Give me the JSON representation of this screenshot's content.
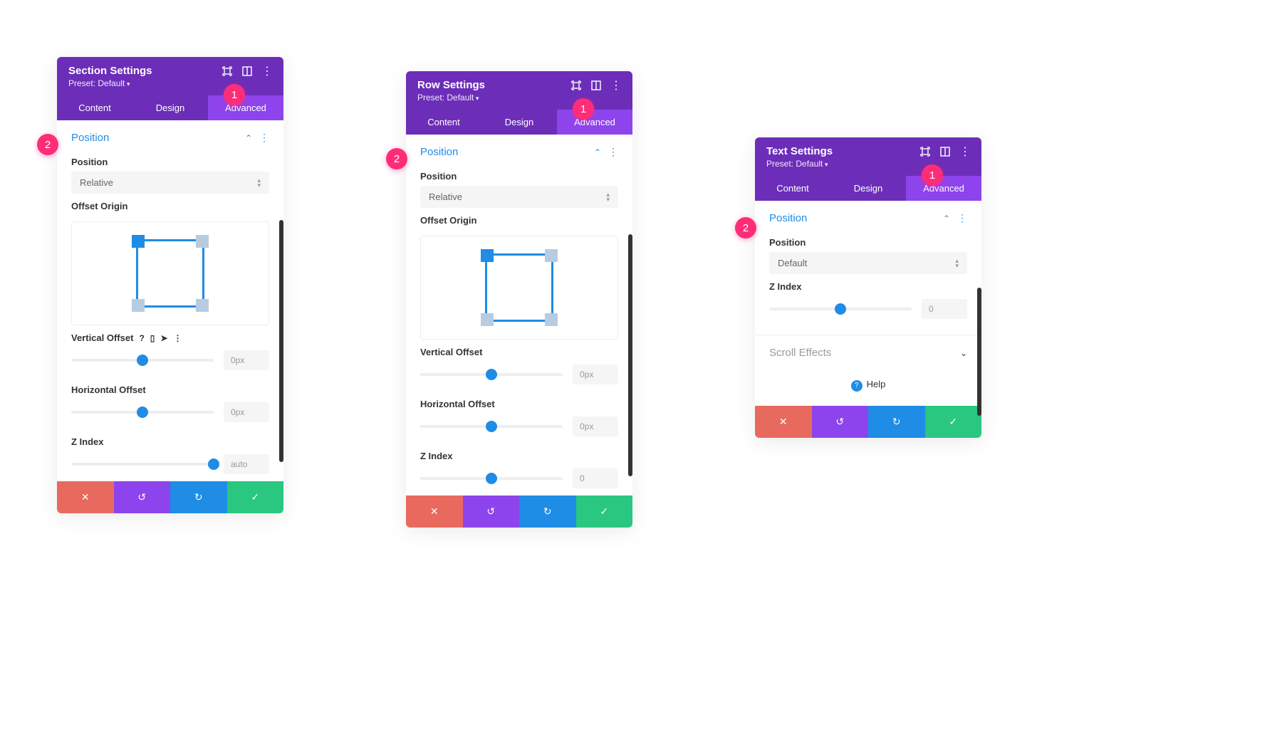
{
  "panels": [
    {
      "title": "Section Settings",
      "preset": "Preset: Default",
      "tabs": [
        "Content",
        "Design",
        "Advanced"
      ],
      "active_tab": 2,
      "position_label": "Position",
      "position_field": "Position",
      "position_value": "Relative",
      "offset_origin": "Offset Origin",
      "vertical_offset": "Vertical Offset",
      "vertical_value": "0px",
      "horizontal_offset": "Horizontal Offset",
      "horizontal_value": "0px",
      "zindex_label": "Z Index",
      "zindex_value": "auto"
    },
    {
      "title": "Row Settings",
      "preset": "Preset: Default",
      "tabs": [
        "Content",
        "Design",
        "Advanced"
      ],
      "active_tab": 2,
      "position_label": "Position",
      "position_field": "Position",
      "position_value": "Relative",
      "offset_origin": "Offset Origin",
      "vertical_offset": "Vertical Offset",
      "vertical_value": "0px",
      "horizontal_offset": "Horizontal Offset",
      "horizontal_value": "0px",
      "zindex_label": "Z Index",
      "zindex_value": "0"
    },
    {
      "title": "Text Settings",
      "preset": "Preset: Default",
      "tabs": [
        "Content",
        "Design",
        "Advanced"
      ],
      "active_tab": 2,
      "position_label": "Position",
      "position_field": "Position",
      "position_value": "Default",
      "zindex_label": "Z Index",
      "zindex_value": "0",
      "scroll_effects": "Scroll Effects",
      "help": "Help"
    }
  ],
  "badges": {
    "one": "1",
    "two": "2"
  }
}
